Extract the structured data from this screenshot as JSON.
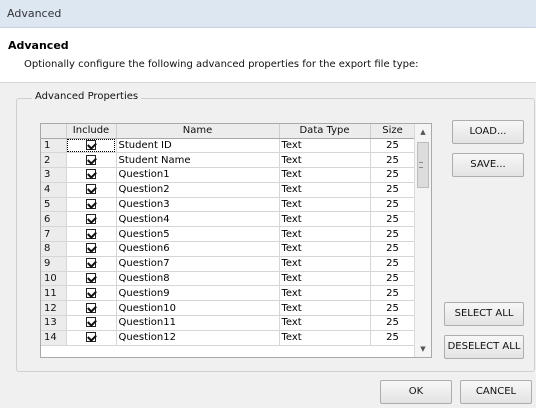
{
  "window": {
    "title": "Advanced"
  },
  "header": {
    "title": "Advanced",
    "description": "Optionally configure the following advanced properties for the export file type:"
  },
  "group": {
    "legend": "Advanced Properties"
  },
  "grid": {
    "columns": [
      "Include",
      "Name",
      "Data Type",
      "Size"
    ],
    "rows": [
      {
        "num": "1",
        "name": "Student ID",
        "type": "Text",
        "size": "25"
      },
      {
        "num": "2",
        "name": "Student Name",
        "type": "Text",
        "size": "25"
      },
      {
        "num": "3",
        "name": "Question1",
        "type": "Text",
        "size": "25"
      },
      {
        "num": "4",
        "name": "Question2",
        "type": "Text",
        "size": "25"
      },
      {
        "num": "5",
        "name": "Question3",
        "type": "Text",
        "size": "25"
      },
      {
        "num": "6",
        "name": "Question4",
        "type": "Text",
        "size": "25"
      },
      {
        "num": "7",
        "name": "Question5",
        "type": "Text",
        "size": "25"
      },
      {
        "num": "8",
        "name": "Question6",
        "type": "Text",
        "size": "25"
      },
      {
        "num": "9",
        "name": "Question7",
        "type": "Text",
        "size": "25"
      },
      {
        "num": "10",
        "name": "Question8",
        "type": "Text",
        "size": "25"
      },
      {
        "num": "11",
        "name": "Question9",
        "type": "Text",
        "size": "25"
      },
      {
        "num": "12",
        "name": "Question10",
        "type": "Text",
        "size": "25"
      },
      {
        "num": "13",
        "name": "Question11",
        "type": "Text",
        "size": "25"
      },
      {
        "num": "14",
        "name": "Question12",
        "type": "Text",
        "size": "25"
      }
    ]
  },
  "buttons": {
    "load": "LOAD...",
    "save": "SAVE...",
    "select_all": "SELECT ALL",
    "deselect_all": "DESELECT ALL",
    "ok": "OK",
    "cancel": "CANCEL"
  },
  "icons": {
    "checkbox": "checkbox-checked-icon",
    "scroll_up": "arrow-up-icon",
    "scroll_down": "arrow-down-icon"
  }
}
